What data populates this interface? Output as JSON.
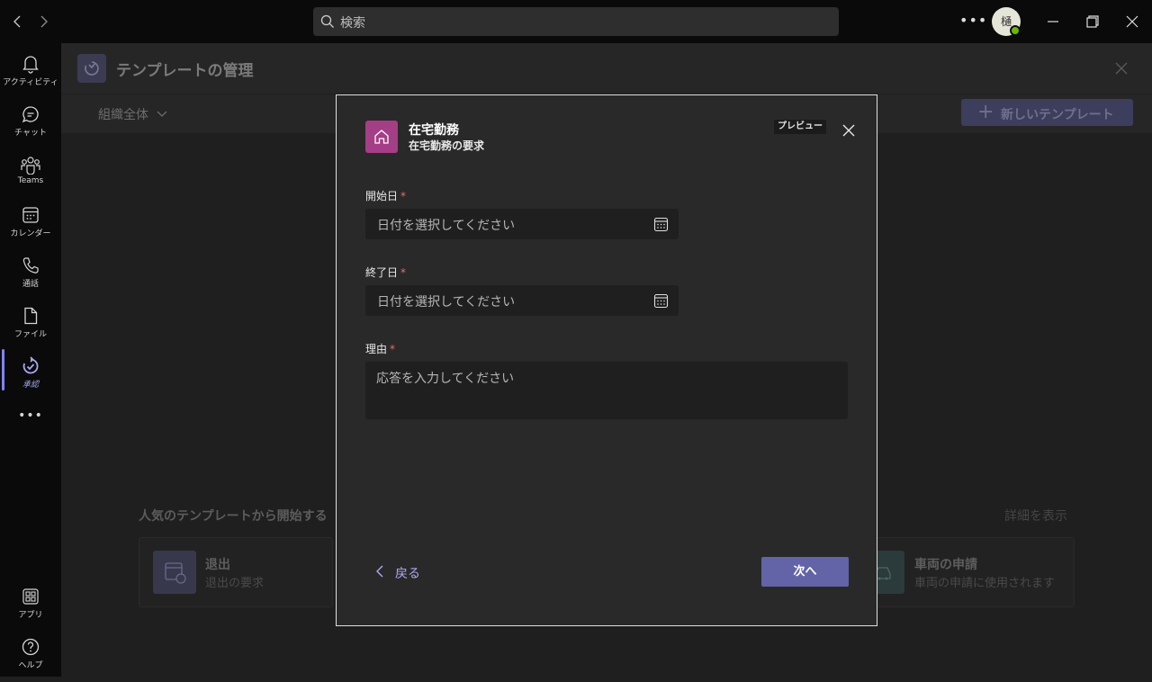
{
  "titlebar": {
    "search_placeholder": "検索",
    "avatar_initial": "樋"
  },
  "rail": {
    "items": [
      {
        "label": "アクティビティ",
        "icon": "bell-icon"
      },
      {
        "label": "チャット",
        "icon": "chat-icon"
      },
      {
        "label": "Teams",
        "icon": "teams-icon"
      },
      {
        "label": "カレンダー",
        "icon": "calendar-icon"
      },
      {
        "label": "通話",
        "icon": "phone-icon"
      },
      {
        "label": "ファイル",
        "icon": "file-icon"
      },
      {
        "label": "承認",
        "icon": "approvals-icon"
      },
      {
        "label": "アプリ",
        "icon": "apps-icon"
      },
      {
        "label": "ヘルプ",
        "icon": "help-icon"
      }
    ],
    "active": "承認"
  },
  "page": {
    "title": "テンプレートの管理",
    "org_filter": "組織全体",
    "new_template_label": "新しいテンプレート",
    "popular_heading": "人気のテンプレートから開始する",
    "details_link": "詳細を表示",
    "cards": [
      {
        "name": "退出",
        "desc": "退出の要求"
      },
      {
        "name": "車両の申請",
        "desc": "車両の申請に使用されます"
      }
    ]
  },
  "dialog": {
    "title": "在宅勤務",
    "subtitle": "在宅勤務の要求",
    "preview_badge": "プレビュー",
    "fields": {
      "start_label": "開始日",
      "start_placeholder": "日付を選択してください",
      "end_label": "終了日",
      "end_placeholder": "日付を選択してください",
      "reason_label": "理由",
      "reason_placeholder": "応答を入力してください",
      "required_marker": "*"
    },
    "back_label": "戻る",
    "next_label": "次へ"
  },
  "colors": {
    "accent": "#6264a7",
    "dialog_icon": "#a43e86",
    "required": "#e86b6b",
    "presence": "#6bb700"
  }
}
